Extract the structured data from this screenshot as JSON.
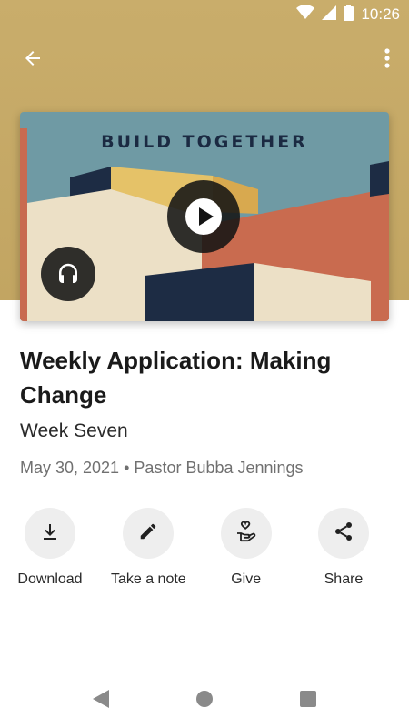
{
  "status_bar": {
    "time": "10:26",
    "icons": [
      "wifi-icon",
      "cell-signal-icon",
      "battery-icon"
    ]
  },
  "top_bar": {
    "back_icon": "arrow-left-icon",
    "more_icon": "more-vertical-icon"
  },
  "artwork": {
    "title": "BUILD TOGETHER",
    "play_icon": "play-icon",
    "audio_icon": "headphones-icon"
  },
  "content": {
    "title": "Weekly Application: Making Change",
    "subtitle": "Week Seven",
    "date": "May 30, 2021",
    "separator": "•",
    "speaker": "Pastor Bubba Jennings"
  },
  "actions": [
    {
      "label": "Download",
      "icon": "download-icon"
    },
    {
      "label": "Take a note",
      "icon": "pencil-icon"
    },
    {
      "label": "Give",
      "icon": "give-heart-hand-icon"
    },
    {
      "label": "Share",
      "icon": "share-icon"
    }
  ],
  "colors": {
    "header_background": "#c4a764",
    "action_circle": "#eeeeee",
    "overlay_button": "#141414"
  }
}
